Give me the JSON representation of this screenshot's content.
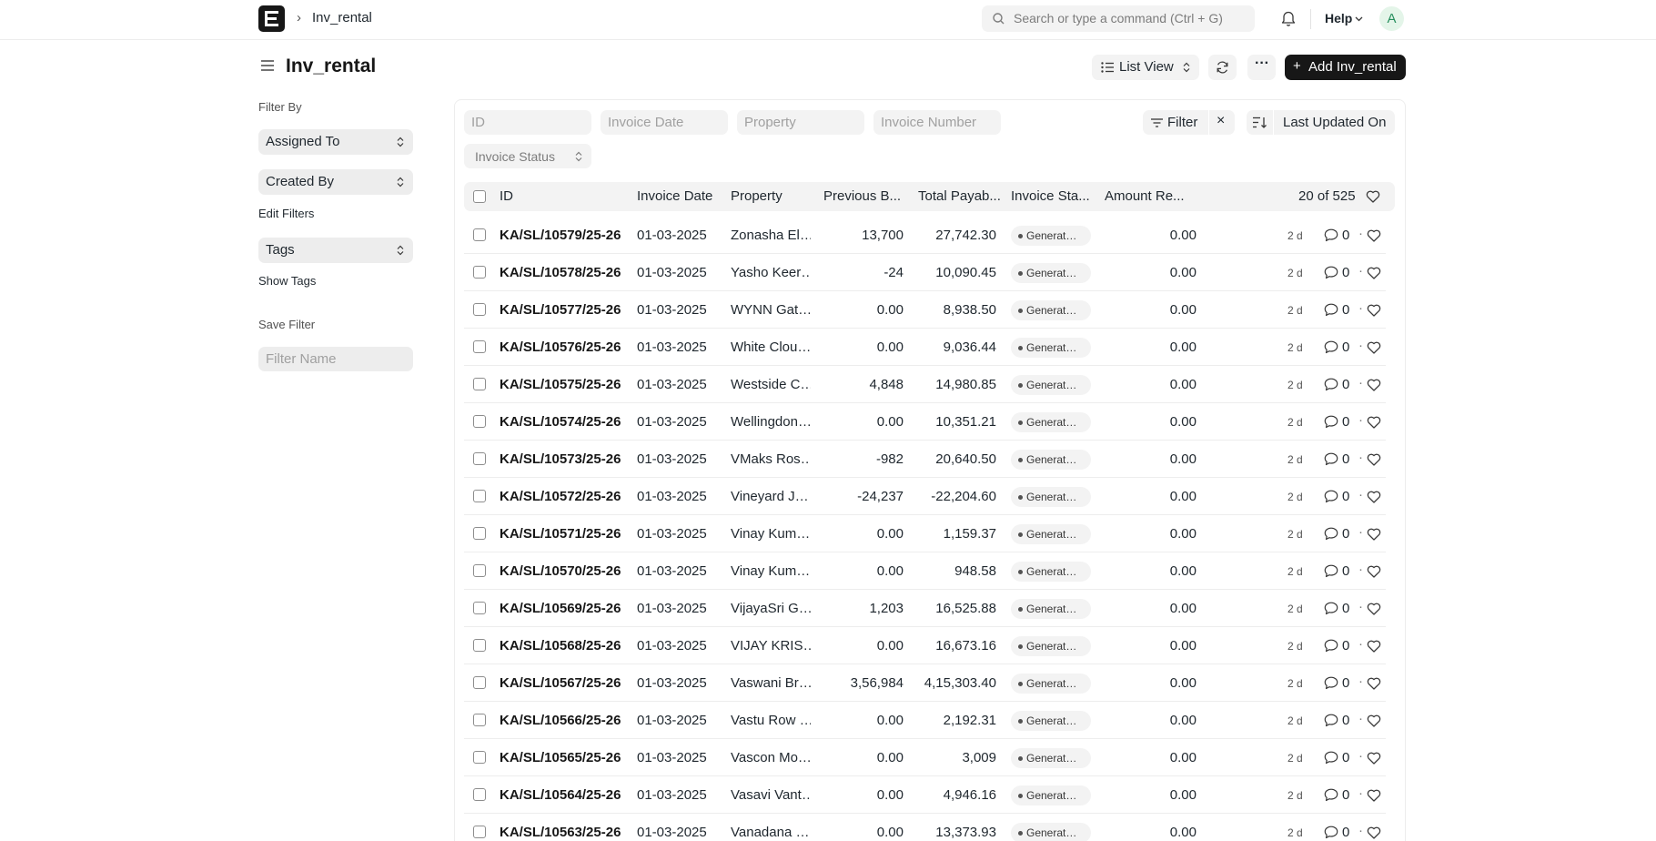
{
  "navbar": {
    "breadcrumb": "Inv_rental",
    "search_placeholder": "Search or type a command (Ctrl + G)",
    "help_label": "Help",
    "avatar_initial": "A"
  },
  "page": {
    "title": "Inv_rental",
    "list_view_label": "List View",
    "add_button_label": "Add Inv_rental"
  },
  "sidebar": {
    "filter_by_label": "Filter By",
    "assigned_to": "Assigned To",
    "created_by": "Created By",
    "edit_filters": "Edit Filters",
    "tags": "Tags",
    "show_tags": "Show Tags",
    "save_filter": "Save Filter",
    "filter_name_placeholder": "Filter Name"
  },
  "filters": {
    "id_placeholder": "ID",
    "invoice_date_placeholder": "Invoice Date",
    "property_placeholder": "Property",
    "invoice_number_placeholder": "Invoice Number",
    "invoice_status": "Invoice Status",
    "filter_label": "Filter",
    "sort_label": "Last Updated On"
  },
  "table": {
    "columns": [
      "ID",
      "Invoice Date",
      "Property",
      "Previous B...",
      "Total Payab...",
      "Invoice Sta...",
      "Amount Re..."
    ],
    "count": "20 of 525",
    "rows": [
      {
        "id": "KA/SL/10579/25-26",
        "date": "01-03-2025",
        "property": "Zonasha El…",
        "previous": "13,700",
        "total": "27,742.30",
        "status": "Generat…",
        "amount": "0.00",
        "modified": "2 d",
        "comments": "0"
      },
      {
        "id": "KA/SL/10578/25-26",
        "date": "01-03-2025",
        "property": "Yasho Keer…",
        "previous": "-24",
        "total": "10,090.45",
        "status": "Generat…",
        "amount": "0.00",
        "modified": "2 d",
        "comments": "0"
      },
      {
        "id": "KA/SL/10577/25-26",
        "date": "01-03-2025",
        "property": "WYNN Gat…",
        "previous": "0.00",
        "total": "8,938.50",
        "status": "Generat…",
        "amount": "0.00",
        "modified": "2 d",
        "comments": "0"
      },
      {
        "id": "KA/SL/10576/25-26",
        "date": "01-03-2025",
        "property": "White Clou…",
        "previous": "0.00",
        "total": "9,036.44",
        "status": "Generat…",
        "amount": "0.00",
        "modified": "2 d",
        "comments": "0"
      },
      {
        "id": "KA/SL/10575/25-26",
        "date": "01-03-2025",
        "property": "Westside C…",
        "previous": "4,848",
        "total": "14,980.85",
        "status": "Generat…",
        "amount": "0.00",
        "modified": "2 d",
        "comments": "0"
      },
      {
        "id": "KA/SL/10574/25-26",
        "date": "01-03-2025",
        "property": "Wellingdon…",
        "previous": "0.00",
        "total": "10,351.21",
        "status": "Generat…",
        "amount": "0.00",
        "modified": "2 d",
        "comments": "0"
      },
      {
        "id": "KA/SL/10573/25-26",
        "date": "01-03-2025",
        "property": "VMaks Ros…",
        "previous": "-982",
        "total": "20,640.50",
        "status": "Generat…",
        "amount": "0.00",
        "modified": "2 d",
        "comments": "0"
      },
      {
        "id": "KA/SL/10572/25-26",
        "date": "01-03-2025",
        "property": "Vineyard J…",
        "previous": "-24,237",
        "total": "-22,204.60",
        "status": "Generat…",
        "amount": "0.00",
        "modified": "2 d",
        "comments": "0"
      },
      {
        "id": "KA/SL/10571/25-26",
        "date": "01-03-2025",
        "property": "Vinay Kum…",
        "previous": "0.00",
        "total": "1,159.37",
        "status": "Generat…",
        "amount": "0.00",
        "modified": "2 d",
        "comments": "0"
      },
      {
        "id": "KA/SL/10570/25-26",
        "date": "01-03-2025",
        "property": "Vinay Kum…",
        "previous": "0.00",
        "total": "948.58",
        "status": "Generat…",
        "amount": "0.00",
        "modified": "2 d",
        "comments": "0"
      },
      {
        "id": "KA/SL/10569/25-26",
        "date": "01-03-2025",
        "property": "VijayaSri G…",
        "previous": "1,203",
        "total": "16,525.88",
        "status": "Generat…",
        "amount": "0.00",
        "modified": "2 d",
        "comments": "0"
      },
      {
        "id": "KA/SL/10568/25-26",
        "date": "01-03-2025",
        "property": "VIJAY KRIS…",
        "previous": "0.00",
        "total": "16,673.16",
        "status": "Generat…",
        "amount": "0.00",
        "modified": "2 d",
        "comments": "0"
      },
      {
        "id": "KA/SL/10567/25-26",
        "date": "01-03-2025",
        "property": "Vaswani Br…",
        "previous": "3,56,984",
        "total": "4,15,303.40",
        "status": "Generat…",
        "amount": "0.00",
        "modified": "2 d",
        "comments": "0"
      },
      {
        "id": "KA/SL/10566/25-26",
        "date": "01-03-2025",
        "property": "Vastu Row …",
        "previous": "0.00",
        "total": "2,192.31",
        "status": "Generat…",
        "amount": "0.00",
        "modified": "2 d",
        "comments": "0"
      },
      {
        "id": "KA/SL/10565/25-26",
        "date": "01-03-2025",
        "property": "Vascon Mo…",
        "previous": "0.00",
        "total": "3,009",
        "status": "Generat…",
        "amount": "0.00",
        "modified": "2 d",
        "comments": "0"
      },
      {
        "id": "KA/SL/10564/25-26",
        "date": "01-03-2025",
        "property": "Vasavi Vant…",
        "previous": "0.00",
        "total": "4,946.16",
        "status": "Generat…",
        "amount": "0.00",
        "modified": "2 d",
        "comments": "0"
      },
      {
        "id": "KA/SL/10563/25-26",
        "date": "01-03-2025",
        "property": "Vanadana …",
        "previous": "0.00",
        "total": "13,373.93",
        "status": "Generat…",
        "amount": "0.00",
        "modified": "2 d",
        "comments": "0"
      }
    ]
  }
}
